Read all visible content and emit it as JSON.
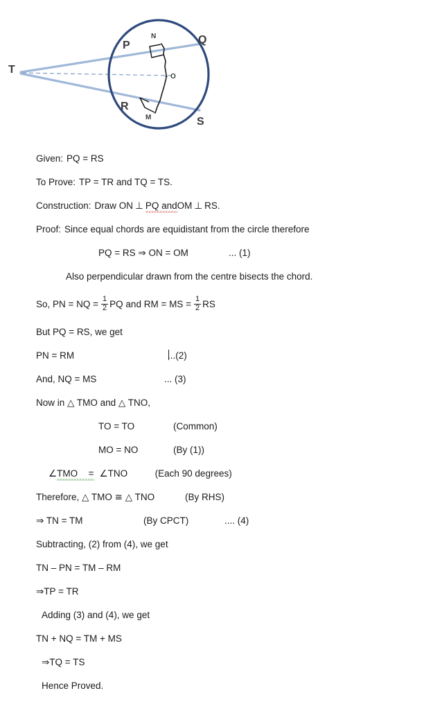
{
  "figure": {
    "caption_points": {
      "T": "T",
      "P": "P",
      "Q": "Q",
      "R": "R",
      "S": "S",
      "N": "N",
      "M": "M",
      "O": "O"
    },
    "colors": {
      "circle_stroke": "#2e4a7d",
      "chord_line": "#9fb8d8",
      "dashed_line": "#8aa4c8",
      "label_text": "#3a3a3a",
      "perpendicular_mark": "#1a1a1a"
    }
  },
  "proof": {
    "given_label": "Given:",
    "given_text": "PQ = RS",
    "to_prove_label": "To Prove:",
    "to_prove_text": "TP  =  TR and TQ  =  TS.",
    "construction_label": "Construction:",
    "construction_a": "Draw ON",
    "construction_perp1": "⊥",
    "construction_b": "PQ",
    "construction_c": " and ",
    "construction_d": "OM",
    "construction_perp2": "⊥",
    "construction_e": "RS.",
    "proof_label": "Proof:",
    "proof_text": "Since equal chords are equidistant from the circle therefore",
    "eq1_text": "PQ = RS  ⇒  ON = OM",
    "eq1_ref": "... (1)",
    "also_text": "Also perpendicular drawn from the centre bisects the chord.",
    "so_prefix": "So, PN  =  NQ  =",
    "frac1_num": "1",
    "frac1_den": "2",
    "so_mid": "PQ  and RM = MS  =",
    "frac2_num": "1",
    "frac2_den": "2",
    "so_suffix": "RS",
    "but_text": "But PQ  =  RS, we get",
    "eq2_text": "PN = RM",
    "eq2_ref": "...(2)",
    "eq3_text": "And, NQ = MS",
    "eq3_ref": "... (3)",
    "now_in_text": "Now in  △ TMO and △ TNO,",
    "cong1_text": "TO  =  TO",
    "cong1_reason": "(Common)",
    "cong2_text": "MO = NO",
    "cong2_reason": "(By (1))",
    "cong3_angle1": "∠",
    "cong3_a": "TMO",
    "cong3_eq": "=",
    "cong3_angle2": "∠",
    "cong3_b": "TNO",
    "cong3_reason": "(Each 90 degrees)",
    "therefore_text": "Therefore, △ TMO ≅  △ TNO",
    "therefore_reason": "(By RHS)",
    "eq4_text": "⇒ TN  =  TM",
    "eq4_reason": "(By CPCT)",
    "eq4_ref": ".... (4)",
    "subtracting_text": "Subtracting, (2) from (4), we get",
    "sub_eq_text": "TN – PN  =  TM – RM",
    "sub_result_text": "⇒TP = TR",
    "adding_text": "Adding (3) and (4), we get",
    "add_eq_text": "TN + NQ  =  TM + MS",
    "add_result_text": "⇒TQ = TS",
    "hence_text": "Hence Proved."
  }
}
